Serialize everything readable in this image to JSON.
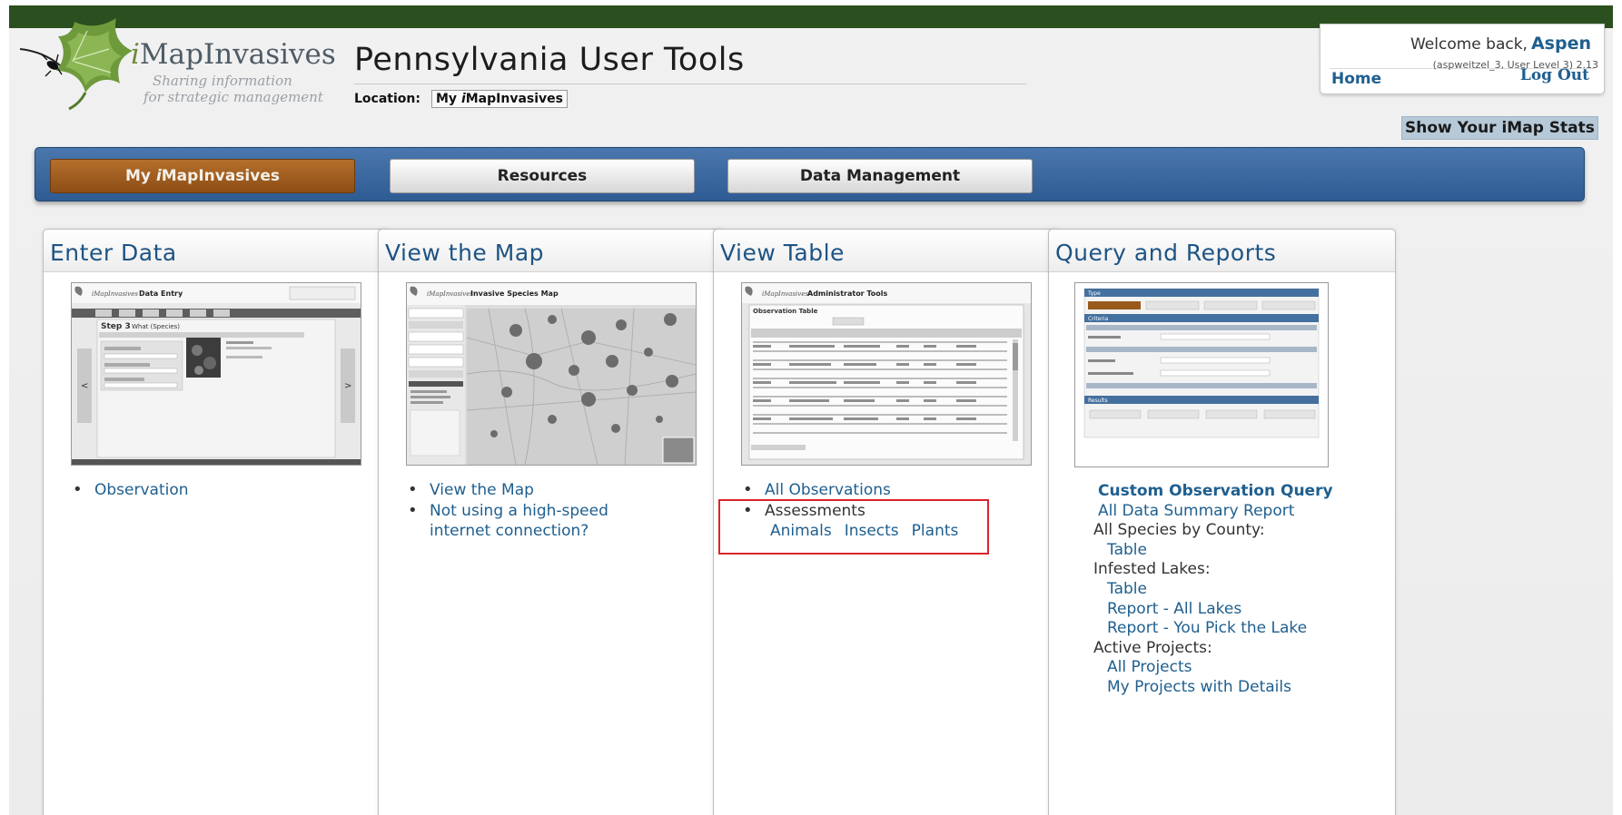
{
  "header": {
    "logo": {
      "name_prefix": "i",
      "name_rest": "MapInvasives",
      "tagline_1": "Sharing information",
      "tagline_2": "for strategic management"
    },
    "title": "Pennsylvania User Tools",
    "location_label": "Location:",
    "location_prefix": "My ",
    "location_italic": "i",
    "location_rest": "MapInvasives"
  },
  "user": {
    "welcome": "Welcome back,",
    "name": "Aspen",
    "info": "(aspweitzel_3, User Level 3) 2.13",
    "home": "Home",
    "logout": "Log Out"
  },
  "stats_button": "Show Your iMap Stats",
  "nav": {
    "tabs": [
      {
        "prefix": "My ",
        "italic": "i",
        "rest": "MapInvasives",
        "active": true
      },
      {
        "label": "Resources",
        "active": false
      },
      {
        "label": "Data Management",
        "active": false
      }
    ]
  },
  "panels": {
    "enter_data": {
      "title": "Enter Data",
      "links": [
        "Observation"
      ]
    },
    "view_map": {
      "title": "View the Map",
      "links": [
        "View the Map",
        "Not using a high-speed internet connection?"
      ]
    },
    "view_table": {
      "title": "View Table",
      "links": [
        "All Observations"
      ],
      "assessments_label": "Assessments",
      "assessments": [
        "Animals",
        "Insects",
        "Plants"
      ]
    },
    "query_reports": {
      "title": "Query and Reports",
      "custom_query": "Custom Observation Query",
      "summary_report": "All Data Summary Report",
      "species_by_county": "All Species by County:",
      "species_table": "Table",
      "infested_lakes": "Infested Lakes:",
      "lakes_table": "Table",
      "lakes_report_all": "Report - All Lakes",
      "lakes_report_pick": "Report - You Pick the Lake",
      "active_projects": "Active Projects:",
      "all_projects": "All Projects",
      "my_projects": "My Projects with Details"
    }
  },
  "thumbnails": {
    "data_entry": {
      "app": "iMapInvasives",
      "title": "Data Entry",
      "step": "Step 3",
      "step_title": "What (Species)",
      "prev": "<",
      "next": ">"
    },
    "species_map": {
      "app": "iMapInvasives",
      "title": "Invasive Species Map"
    },
    "admin_table": {
      "app": "iMapInvasives",
      "title": "Administrator Tools",
      "table_title": "Observation Table"
    },
    "query": {
      "type_label": "Type",
      "criteria_label": "Criteria",
      "results_label": "Results"
    }
  },
  "colors": {
    "topbar": "#2c4f1f",
    "nav": "#3a679f",
    "active_tab": "#a0601f",
    "link": "#1f5f8f",
    "highlight": "#d9252c"
  }
}
